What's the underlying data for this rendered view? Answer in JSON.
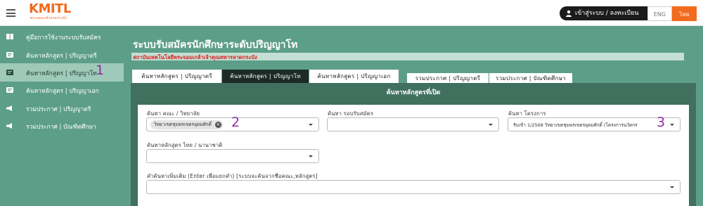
{
  "app": {
    "logo_text": "KMITL",
    "logo_subtext": "พระจอมเกล้าลาดกระบัง",
    "login_label": "เข้าสู่ระบบ / ลงทะเบียน",
    "lang_en": "ENG",
    "lang_th": "ไทย",
    "accent_color": "#f26a1b"
  },
  "sidebar": {
    "items": [
      {
        "label": "คู่มือการใช้งานระบบรับสมัคร",
        "icon": "book-icon"
      },
      {
        "label": "ค้นหาหลักสูตร | ปริญญาตรี",
        "icon": "search-list-icon"
      },
      {
        "label": "ค้นหาหลักสูตร | ปริญญาโท",
        "icon": "search-list-icon"
      },
      {
        "label": "ค้นหาหลักสูตร | ปริญญาเอก",
        "icon": "search-list-icon"
      },
      {
        "label": "รวมประกาศ | ปริญญาตรี",
        "icon": "megaphone-icon"
      },
      {
        "label": "รวมประกาศ | บัณฑิตศึกษา",
        "icon": "megaphone-icon"
      }
    ],
    "active_index": 2
  },
  "markers": [
    "1",
    "2",
    "3"
  ],
  "main": {
    "title": "ระบบรับสมัครนักศึกษาระดับปริญญาโท",
    "subtitle": "สถาบันเทคโนโลยีพระจอมเกล้าเจ้าคุณทหารลาดกระบัง",
    "tabs": [
      "ค้นหาหลักสูตร | ปริญญาตรี",
      "ค้นหาหลักสูตร | ปริญญาโท",
      "ค้นหาหลักสูตร | ปริญญาเอก",
      "รวมประกาศ | ปริญญาตรี",
      "รวมประกาศ | บัณฑิตศึกษา"
    ],
    "panel_title": "ค้นหาหลักสูตรที่เปิด",
    "filters": {
      "faculty_label": "ค้นหา คณะ / วิทยาลัย",
      "faculty_value": "วิทยาเขตชุมพรเขตรอุดมศักดิ์",
      "round_label": "ค้นหา รอบรับสมัคร",
      "round_value": "",
      "project_label": "ค้นหา โครงการ",
      "project_value": "รับเข้า 1/2568 วิทยาเขตชุมพรเขตรอุดมศักดิ์ (โครงการนวัตกร",
      "program_type_label": "ค้นหาหลักสูตร ไทย / นานาชาติ",
      "program_type_value": "",
      "keyword_label": "คำค้นหาเพิ่มเติม (Enter เพื่อแยกคำ) [ระบบจะค้นจากชื่อคณะ,หลักสูตร]",
      "keyword_value": ""
    }
  }
}
